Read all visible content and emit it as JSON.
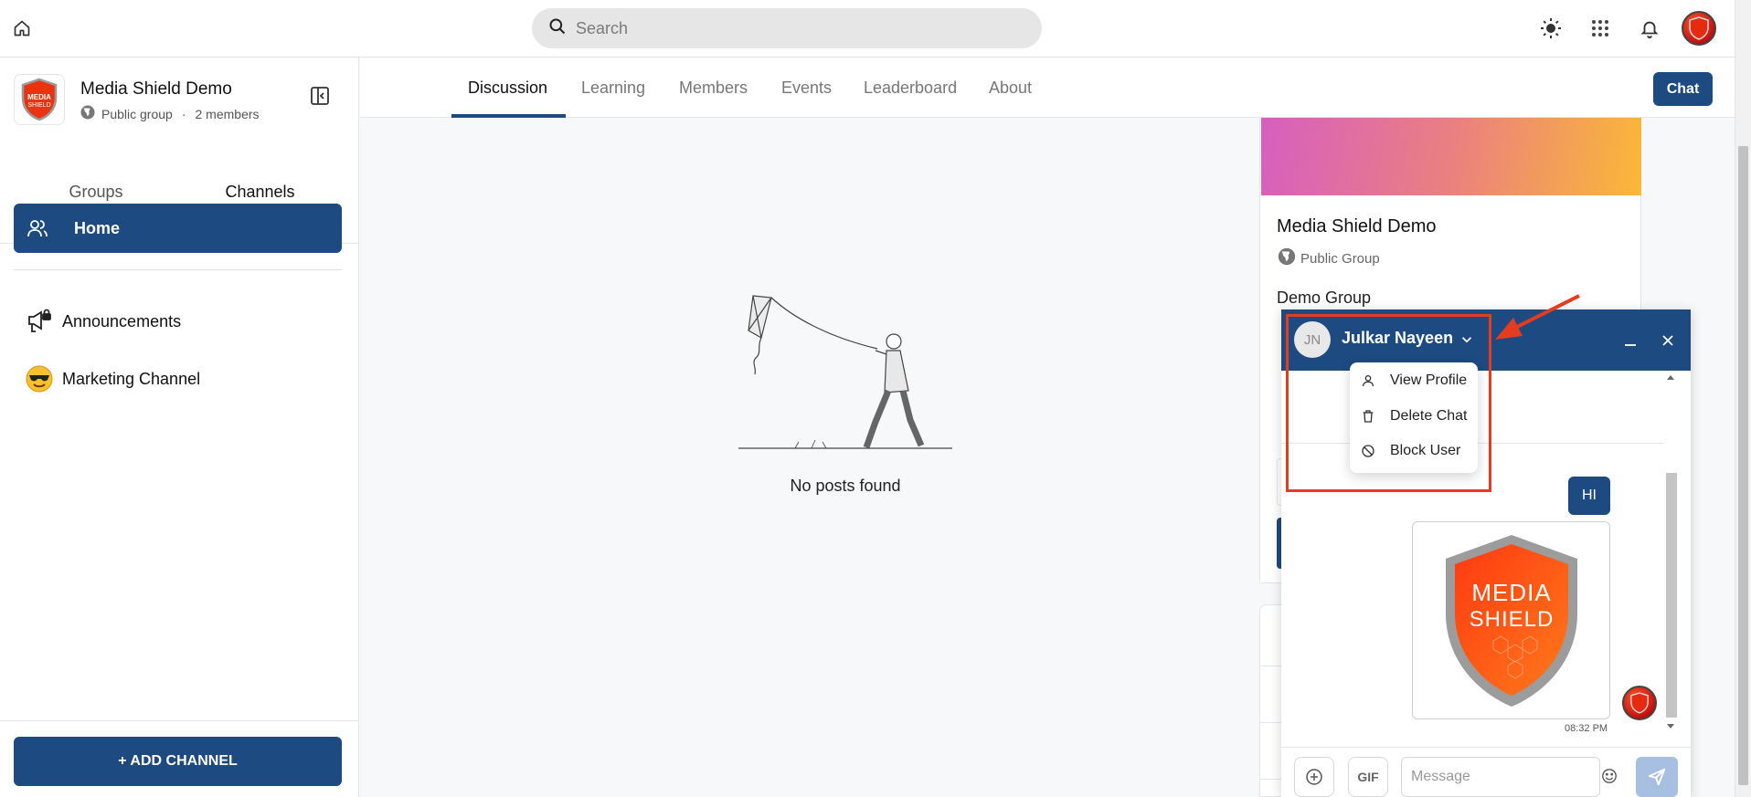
{
  "topbar": {
    "home_icon": "home-icon",
    "search_placeholder": "Search",
    "icons": [
      "sun-icon",
      "apps-grid-icon",
      "bell-icon"
    ],
    "avatar_text": "MEDIA SHIELD"
  },
  "sidebar": {
    "group_name": "Media Shield Demo",
    "group_type": "Public group",
    "separator": "·",
    "member_count": "2 members",
    "tabs": [
      {
        "label": "Groups"
      },
      {
        "label": "Channels"
      }
    ],
    "active_tab": "Channels",
    "home_label": "Home",
    "channels": [
      {
        "label": "Announcements",
        "icon": "megaphone-lock-icon"
      },
      {
        "label": "Marketing Channel",
        "icon": "sunglasses-emoji-icon"
      }
    ],
    "add_channel_label": "+ ADD CHANNEL"
  },
  "subnav": {
    "tabs": [
      {
        "label": "Discussion"
      },
      {
        "label": "Learning"
      },
      {
        "label": "Members"
      },
      {
        "label": "Events"
      },
      {
        "label": "Leaderboard"
      },
      {
        "label": "About"
      }
    ],
    "active_tab": "Discussion",
    "chat_label": "Chat"
  },
  "feed": {
    "empty_text": "No posts found"
  },
  "right_panel": {
    "title": "Media Shield Demo",
    "type": "Public Group",
    "description": "Demo Group"
  },
  "chat": {
    "avatar_initials": "JN",
    "contact_name": "Julkar Nayeen",
    "menu": [
      {
        "label": "View Profile",
        "icon": "user-icon"
      },
      {
        "label": "Delete Chat",
        "icon": "trash-icon"
      },
      {
        "label": "Block User",
        "icon": "block-icon"
      }
    ],
    "messages": [
      {
        "text": "HI"
      }
    ],
    "image_logo_text_1": "MEDIA",
    "image_logo_text_2": "SHIELD",
    "timestamp": "08:32 PM",
    "gif_label": "GIF",
    "input_placeholder": "Message"
  },
  "colors": {
    "brand_blue": "#1d4a80",
    "annotation_red": "#e53b1f"
  }
}
